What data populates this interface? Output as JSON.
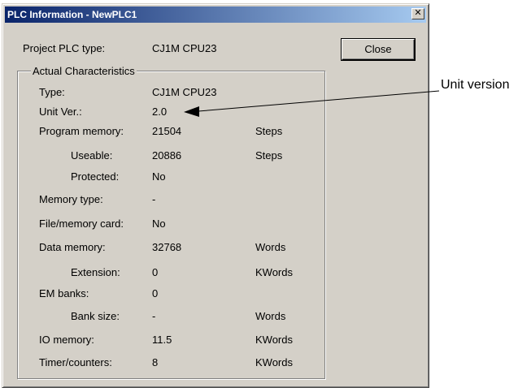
{
  "window": {
    "title": "PLC Information - NewPLC1",
    "close_glyph": "✕"
  },
  "project": {
    "label": "Project PLC type:",
    "value": "CJ1M CPU23"
  },
  "close_button": "Close",
  "group": {
    "title": "Actual Characteristics",
    "rows": [
      {
        "label": "Type:",
        "value": "CJ1M CPU23",
        "unit": ""
      },
      {
        "label": "Unit Ver.:",
        "value": "2.0",
        "unit": ""
      },
      {
        "label": "Program memory:",
        "value": "21504",
        "unit": "Steps"
      },
      {
        "label": "Useable:",
        "value": "20886",
        "unit": "Steps"
      },
      {
        "label": "Protected:",
        "value": "No",
        "unit": ""
      },
      {
        "label": "Memory type:",
        "value": "-",
        "unit": ""
      },
      {
        "label": "File/memory card:",
        "value": "No",
        "unit": ""
      },
      {
        "label": "Data memory:",
        "value": "32768",
        "unit": "Words"
      },
      {
        "label": "Extension:",
        "value": "0",
        "unit": "KWords"
      },
      {
        "label": "EM banks:",
        "value": "0",
        "unit": ""
      },
      {
        "label": "Bank size:",
        "value": "-",
        "unit": "Words"
      },
      {
        "label": "IO memory:",
        "value": "11.5",
        "unit": "KWords"
      },
      {
        "label": "Timer/counters:",
        "value": "8",
        "unit": "KWords"
      }
    ]
  },
  "callout": "Unit version",
  "colors": {
    "titlebar_start": "#0a246a",
    "titlebar_end": "#a6caf0",
    "dialog_face": "#d4d0c8"
  }
}
